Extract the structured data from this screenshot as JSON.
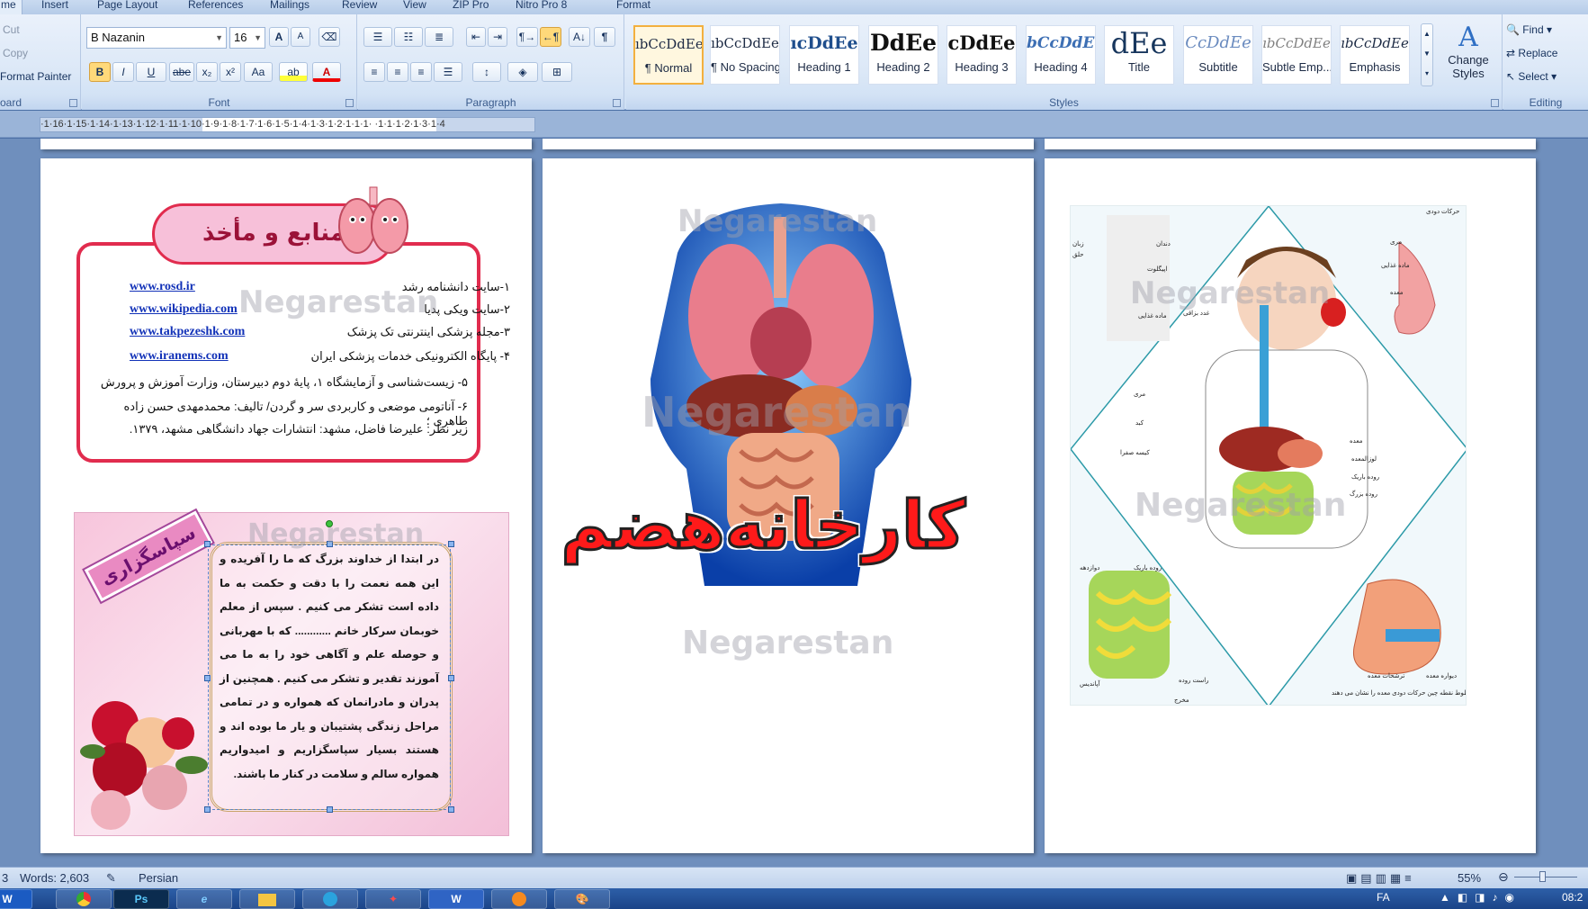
{
  "ribbon_tabs": [
    "me",
    "Insert",
    "Page Layout",
    "References",
    "Mailings",
    "Review",
    "View",
    "ZIP Pro",
    "Nitro Pro 8",
    "Format"
  ],
  "clipboard": {
    "cut": "Cut",
    "copy": "Copy",
    "format_painter": "Format Painter",
    "label": "oard"
  },
  "font": {
    "name": "B Nazanin",
    "size": "16",
    "label": "Font",
    "grow": "A",
    "shrink": "A",
    "bold": "B",
    "italic": "I",
    "underline": "U",
    "strike": "abe",
    "sub": "x₂",
    "sup": "x²",
    "case": "Aa",
    "highlight": "ab",
    "color": "A"
  },
  "paragraph": {
    "label": "Paragraph",
    "pilcrow": "¶"
  },
  "styles": {
    "label": "Styles",
    "items": [
      {
        "sample": "ıbCcDdEe",
        "name": "¶ Normal"
      },
      {
        "sample": "ıbCcDdEe",
        "name": "¶ No Spacing"
      },
      {
        "sample": "ıcDdEe",
        "name": "Heading 1"
      },
      {
        "sample": "DdEe",
        "name": "Heading 2"
      },
      {
        "sample": "cDdEe",
        "name": "Heading 3"
      },
      {
        "sample": "bCcDdEe",
        "name": "Heading 4"
      },
      {
        "sample": "dEe",
        "name": "Title"
      },
      {
        "sample": "CcDdEe",
        "name": "Subtitle"
      },
      {
        "sample": "ıbCcDdEe",
        "name": "Subtle Emp..."
      },
      {
        "sample": "ıbCcDdEe",
        "name": "Emphasis"
      }
    ],
    "change_styles": "Change Styles"
  },
  "editing": {
    "label": "Editing",
    "find": "Find",
    "replace": "Replace",
    "select": "Select"
  },
  "ruler": {
    "text": "·1·16·1·15·1·14·1·13·1·12·1·11·1·10·1·9·1·8·1·7·1·6·1·5·1·4·1·3·1·2·1·1·1·    ·1·1·1·2·1·3·1·4"
  },
  "left_page": {
    "refs_title": "منابع و مأخذ",
    "refs": [
      {
        "url": "www.rosd.ir",
        "text": "۱-سایت دانشنامه رشد"
      },
      {
        "url": "www.wikipedia.com",
        "text": "۲-سایت ویکی پدیا"
      },
      {
        "url": "www.takpezeshk.com",
        "text": "۳-مجله پزشکی اینترنتی تک پزشک"
      },
      {
        "url": "www.iranems.com",
        "text": "۴- پایگاه الکترونیکی خدمات پزشکی ایران"
      }
    ],
    "refs_long": [
      "۵- زیست‌شناسی و آزمایشگاه ۱، پایهٔ دوم دبیرستان، وزارت آموزش و پرورش",
      "۶- آناتومی موضعی و کاربردی سر و گردن/ تالیف: محمدمهدی حسن زاده طاهری ؛",
      "زیر نظر: علیرضا فاضل، مشهد: انتشارات جهاد دانشگاهی مشهد، ۱۳۷۹."
    ],
    "thanks_title": "سپاسگزاری",
    "thanks_text": "در ابتدا از خداوند بزرگ که ما را آفریده و این همه نعمت را با دقت و حکمت به ما داده است تشکر می کنیم . سپس از معلم خوبمان سرکار خانم ............ که با مهربانی و حوصله علم و آگاهی خود را به ما می آموزند تقدیر و تشکر می کنیم . همچنین از پدران و مادرانمان که همواره و در تمامی مراحل زندگی پشتیبان و یار ما بوده اند و هستند بسیار سپاسگزاریم و امیدواریم همواره سالم و سلامت در کنار ما باشند."
  },
  "middle_page": {
    "title": "کارخانه‌هضم",
    "watermark": "Negarestan"
  },
  "right_page": {
    "labels": [
      "حرکات دودی",
      "مری",
      "ماده غذایی",
      "معده",
      "زبان",
      "حلق",
      "دندان",
      "اپیگلوت",
      "غدد بزاقی",
      "ماده غذایی",
      "مری",
      "کبد",
      "کیسه صفرا",
      "معده",
      "لوزالمعده",
      "روده باریک",
      "روده بزرگ",
      "دوازدهه",
      "روده باریک",
      "آپاندیس",
      "راست روده",
      "مخرج",
      "دیواره معده",
      "ترشحات معده",
      "خطوط نقطه چین حرکات دودی معده را نشان می دهند"
    ]
  },
  "statusbar": {
    "page": "3",
    "words": "Words: 2,603",
    "language": "Persian",
    "zoom": "55%"
  },
  "taskbar": {
    "apps": [
      "W",
      "",
      "Ps",
      "e",
      "",
      "",
      "",
      "W",
      "",
      ""
    ],
    "lang": "FA",
    "time": "08:2"
  },
  "colors": {
    "refs_border": "#e12c4e",
    "title_red": "#ff1a1a",
    "ribbon_bg": "#dce8f7"
  }
}
